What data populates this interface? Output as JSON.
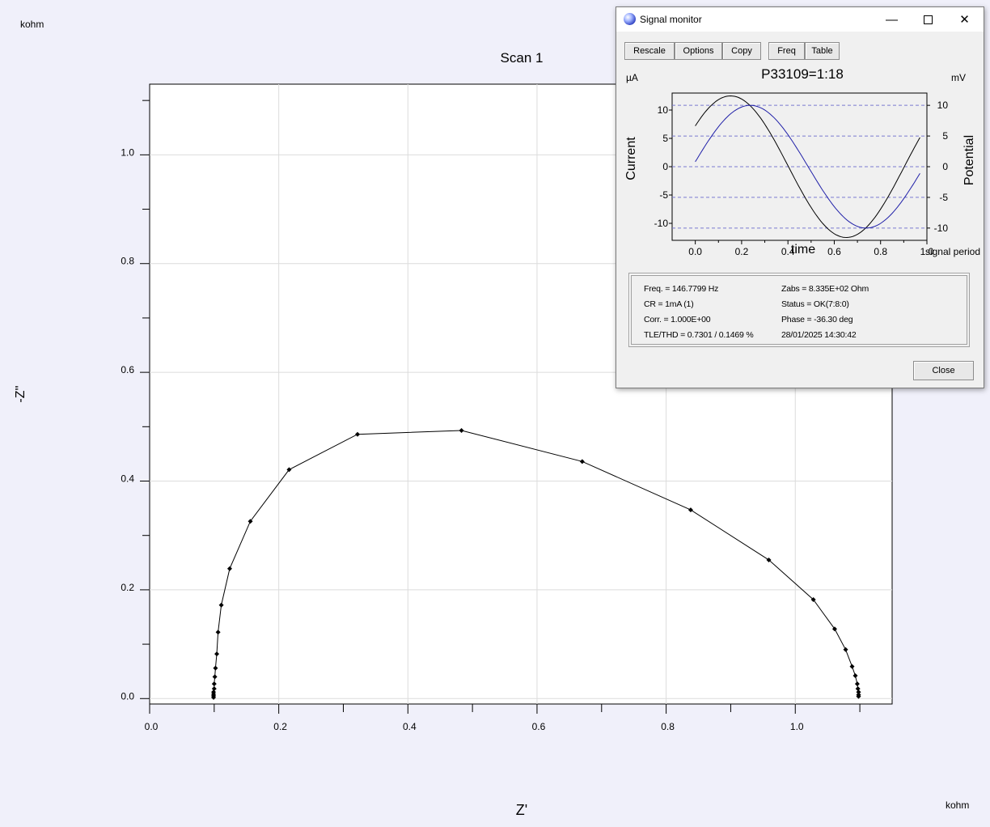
{
  "plot": {
    "title": "Scan 1",
    "y_unit": "kohm",
    "x_unit": "kohm",
    "y_label": "-Z''",
    "x_label": "Z'",
    "x_ticks": [
      "0.0",
      "0.2",
      "0.4",
      "0.6",
      "0.8",
      "1.0"
    ],
    "y_ticks": [
      "0.0",
      "0.2",
      "0.4",
      "0.6",
      "0.8",
      "1.0"
    ]
  },
  "chart_data": [
    {
      "type": "scatter",
      "title": "Scan 1",
      "xlabel": "Z'",
      "ylabel": "-Z''",
      "x_unit": "kohm",
      "y_unit": "kohm",
      "xlim": [
        0.0,
        1.15
      ],
      "ylim": [
        -0.01,
        1.13
      ],
      "grid": true,
      "series": [
        {
          "x": [
            0.099,
            0.099,
            0.099,
            0.099,
            0.1,
            0.1,
            0.101,
            0.102,
            0.104,
            0.106,
            0.111,
            0.124,
            0.156,
            0.216,
            0.322,
            0.483,
            0.67,
            0.838,
            0.959,
            1.028,
            1.061,
            1.078,
            1.088,
            1.093,
            1.096,
            1.097,
            1.098,
            1.098,
            1.098
          ],
          "y": [
            0.002,
            0.005,
            0.008,
            0.012,
            0.018,
            0.027,
            0.04,
            0.056,
            0.082,
            0.122,
            0.172,
            0.239,
            0.326,
            0.421,
            0.486,
            0.493,
            0.436,
            0.347,
            0.255,
            0.182,
            0.128,
            0.09,
            0.059,
            0.042,
            0.027,
            0.018,
            0.012,
            0.007,
            0.004
          ],
          "line": true
        }
      ]
    },
    {
      "type": "line",
      "title": "P33109=1:18",
      "xlabel": "time",
      "x_unit": "signal period",
      "ylabel": "Current",
      "y_unit": "µA",
      "y2label": "Potential",
      "y2_unit": "mV",
      "xlim": [
        -0.1,
        1.0
      ],
      "ylim": [
        -13,
        13
      ],
      "y2lim": [
        -12,
        12
      ],
      "series": [
        {
          "name": "Current",
          "color": "#000000",
          "amplitude": 12.5,
          "offset": 7.2,
          "period_fraction": 1.0
        },
        {
          "name": "Potential",
          "color": "#1f1fa8",
          "amplitude": 10.0,
          "offset": 0.8,
          "period_fraction": 1.0
        }
      ]
    }
  ],
  "monitor": {
    "title": "Signal monitor",
    "buttons": {
      "rescale": "Rescale",
      "options": "Options",
      "copy": "Copy",
      "freq": "Freq",
      "table": "Table",
      "close": "Close"
    },
    "chart": {
      "title": "P33109=1:18",
      "left_unit": "µA",
      "right_unit": "mV",
      "left_label": "Current",
      "right_label": "Potential",
      "x_label": "time",
      "x_unit": "signal period",
      "x_ticks": [
        "0.0",
        "0.2",
        "0.4",
        "0.6",
        "0.8",
        "1.0"
      ],
      "left_ticks": [
        "10",
        "5",
        "0",
        "-5",
        "-10"
      ],
      "right_ticks": [
        "10",
        "5",
        "0",
        "-5",
        "-10"
      ]
    },
    "info": {
      "freq": "Freq. = 146.7799 Hz",
      "cr": "CR = 1mA (1)",
      "corr": "Corr. = 1.000E+00",
      "tle": "TLE/THD = 0.7301 / 0.1469 %",
      "zabs": "Zabs  = 8.335E+02 Ohm",
      "status": "Status = OK(7:8:0)",
      "phase": "Phase = -36.30 deg",
      "timestamp": "28/01/2025 14:30:42"
    }
  },
  "colors": {
    "background": "#f0f0fa",
    "plot_bg": "#ffffff",
    "grid": "#dcdcdc",
    "potential": "#1f1fa8",
    "current": "#000000"
  }
}
